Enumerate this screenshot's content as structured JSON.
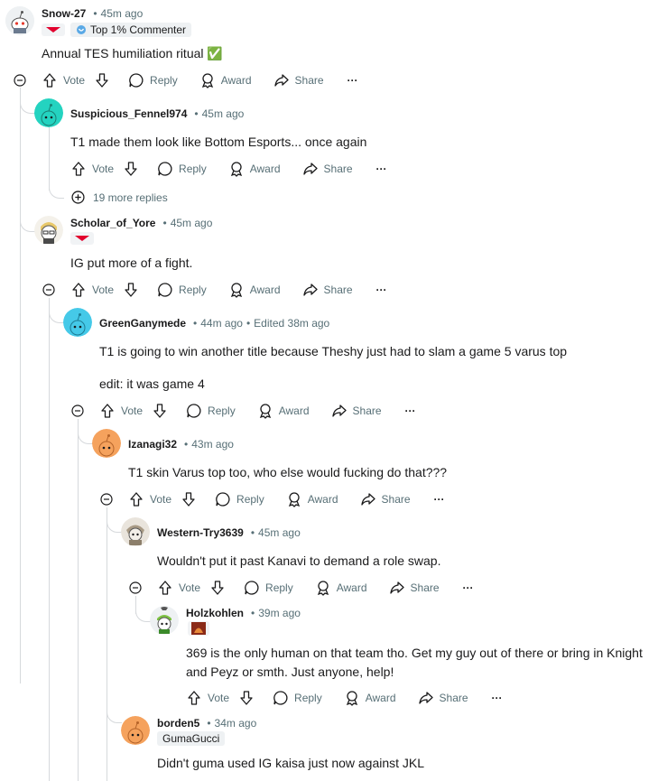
{
  "action_labels": {
    "vote": "Vote",
    "reply": "Reply",
    "award": "Award",
    "share": "Share",
    "more": "···"
  },
  "comments": [
    {
      "username": "Snow-27",
      "time": "45m ago",
      "badge": "Top 1% Commenter",
      "text": "Annual TES humiliation ritual ✅"
    },
    {
      "username": "Suspicious_Fennel974",
      "time": "45m ago",
      "text": "T1 made them look like Bottom Esports... once again",
      "more_replies": "19 more replies"
    },
    {
      "username": "Scholar_of_Yore",
      "time": "45m ago",
      "text": "IG put more of a fight."
    },
    {
      "username": "GreenGanymede",
      "time": "44m ago",
      "edited": "Edited 38m ago",
      "text": "T1 is going to win another title because Theshy just had to slam a game 5 varus top",
      "text2": "edit: it was game 4"
    },
    {
      "username": "Izanagi32",
      "time": "43m ago",
      "text": "T1 skin Varus top too, who else would fucking do that???"
    },
    {
      "username": "Western-Try3639",
      "time": "45m ago",
      "text": "Wouldn't put it past Kanavi to demand a role swap."
    },
    {
      "username": "Holzkohlen",
      "time": "39m ago",
      "text": "369 is the only human on that team tho. Get my guy out of there or bring in Knight and Peyz or smth. Just anyone, help!"
    },
    {
      "username": "borden5",
      "time": "34m ago",
      "flair": "GumaGucci",
      "text": "Didn't guma used IG kaisa just now against JKL"
    }
  ],
  "colors": {
    "thread_line": "#d6d9dc",
    "meta_text": "#576f76",
    "t1_red": "#e2012d",
    "avatar_teal": "#24d3c0",
    "avatar_cyan": "#45c9e8",
    "avatar_orange": "#f5a25d"
  }
}
